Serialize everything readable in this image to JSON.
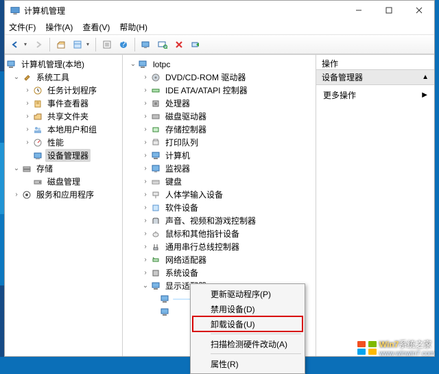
{
  "titlebar": {
    "title": "计算机管理"
  },
  "menus": {
    "file": "文件(F)",
    "action": "操作(A)",
    "view": "查看(V)",
    "help": "帮助(H)"
  },
  "left_tree": {
    "root": "计算机管理(本地)",
    "systools": "系统工具",
    "systools_children": [
      "任务计划程序",
      "事件查看器",
      "共享文件夹",
      "本地用户和组",
      "性能",
      "设备管理器"
    ],
    "storage": "存储",
    "storage_children": [
      "磁盘管理"
    ],
    "services": "服务和应用程序"
  },
  "mid_tree": {
    "root": "lotpc",
    "items": [
      "DVD/CD-ROM 驱动器",
      "IDE ATA/ATAPI 控制器",
      "处理器",
      "磁盘驱动器",
      "存储控制器",
      "打印队列",
      "计算机",
      "监视器",
      "键盘",
      "人体学输入设备",
      "软件设备",
      "声音、视频和游戏控制器",
      "鼠标和其他指针设备",
      "通用串行总线控制器",
      "网络适配器",
      "系统设备",
      "显示适配器"
    ],
    "highlighted_child": ""
  },
  "right": {
    "header": "操作",
    "selected": "设备管理器",
    "more": "更多操作"
  },
  "ctx": {
    "update": "更新驱动程序(P)",
    "disable": "禁用设备(D)",
    "uninstall": "卸载设备(U)",
    "scan": "扫描检测硬件改动(A)",
    "props": "属性(R)"
  },
  "watermark": {
    "brand": "Win7",
    "suffix": "系统之家",
    "url": "www.winwin7.com"
  },
  "chart_data": null
}
